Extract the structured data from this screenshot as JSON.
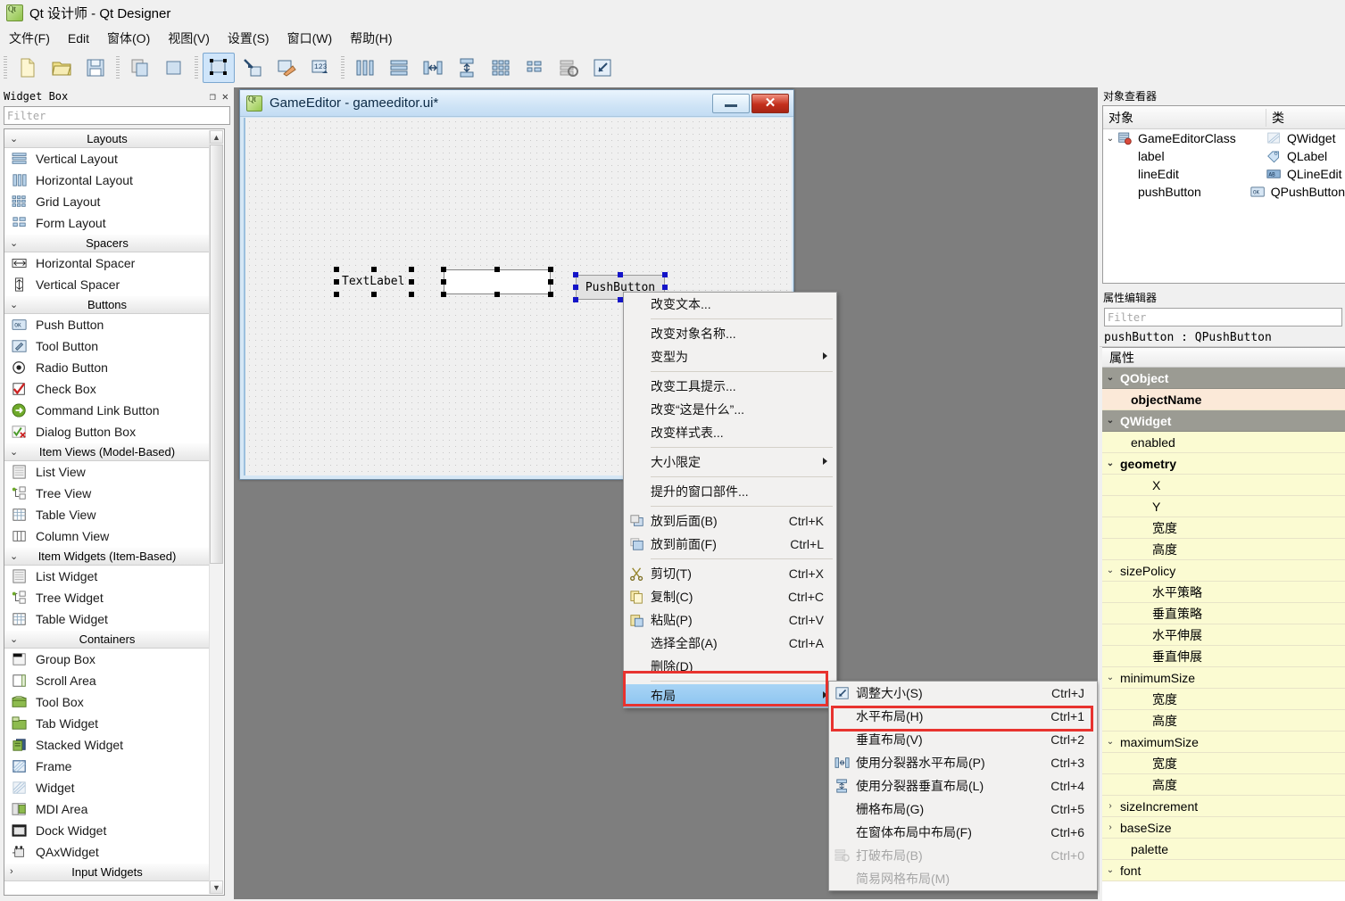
{
  "window": {
    "title": "Qt 设计师 - Qt Designer",
    "app_icon": "qt-icon"
  },
  "menubar": {
    "items": [
      {
        "label": "文件(F)"
      },
      {
        "label": "Edit"
      },
      {
        "label": "窗体(O)"
      },
      {
        "label": "视图(V)"
      },
      {
        "label": "设置(S)"
      },
      {
        "label": "窗口(W)"
      },
      {
        "label": "帮助(H)"
      }
    ]
  },
  "toolbar": {
    "groups": [
      [
        "new-form-icon",
        "open-form-icon",
        "save-form-icon"
      ],
      [
        "copy-icon",
        "paste-icon"
      ],
      [
        "edit-widgets-icon",
        "edit-signals-icon",
        "edit-buddies-icon",
        "edit-tab-order-icon"
      ],
      [
        "layout-horizontal-icon",
        "layout-vertical-icon",
        "layout-splitter-h-icon",
        "layout-splitter-v-icon",
        "layout-grid-icon",
        "layout-form-icon",
        "break-layout-icon",
        "adjust-size-icon"
      ]
    ],
    "active_index": "edit-widgets-icon"
  },
  "widget_box": {
    "title": "Widget Box",
    "float_btn": "float-icon",
    "close_btn": "close-icon",
    "filter_placeholder": "Filter",
    "groups": [
      {
        "name": "Layouts",
        "expanded": true,
        "items": [
          {
            "label": "Vertical Layout",
            "icon": "vertical-layout-icon"
          },
          {
            "label": "Horizontal Layout",
            "icon": "horizontal-layout-icon"
          },
          {
            "label": "Grid Layout",
            "icon": "grid-layout-icon"
          },
          {
            "label": "Form Layout",
            "icon": "form-layout-icon"
          }
        ]
      },
      {
        "name": "Spacers",
        "expanded": true,
        "items": [
          {
            "label": "Horizontal Spacer",
            "icon": "horizontal-spacer-icon"
          },
          {
            "label": "Vertical Spacer",
            "icon": "vertical-spacer-icon"
          }
        ]
      },
      {
        "name": "Buttons",
        "expanded": true,
        "items": [
          {
            "label": "Push Button",
            "icon": "push-button-icon"
          },
          {
            "label": "Tool Button",
            "icon": "tool-button-icon"
          },
          {
            "label": "Radio Button",
            "icon": "radio-button-icon"
          },
          {
            "label": "Check Box",
            "icon": "check-box-icon"
          },
          {
            "label": "Command Link Button",
            "icon": "command-link-icon"
          },
          {
            "label": "Dialog Button Box",
            "icon": "dialog-button-box-icon"
          }
        ]
      },
      {
        "name": "Item Views (Model-Based)",
        "expanded": true,
        "items": [
          {
            "label": "List View",
            "icon": "list-view-icon"
          },
          {
            "label": "Tree View",
            "icon": "tree-view-icon"
          },
          {
            "label": "Table View",
            "icon": "table-view-icon"
          },
          {
            "label": "Column View",
            "icon": "column-view-icon"
          }
        ]
      },
      {
        "name": "Item Widgets (Item-Based)",
        "expanded": true,
        "items": [
          {
            "label": "List Widget",
            "icon": "list-widget-icon"
          },
          {
            "label": "Tree Widget",
            "icon": "tree-widget-icon"
          },
          {
            "label": "Table Widget",
            "icon": "table-widget-icon"
          }
        ]
      },
      {
        "name": "Containers",
        "expanded": true,
        "items": [
          {
            "label": "Group Box",
            "icon": "group-box-icon"
          },
          {
            "label": "Scroll Area",
            "icon": "scroll-area-icon"
          },
          {
            "label": "Tool Box",
            "icon": "tool-box-icon"
          },
          {
            "label": "Tab Widget",
            "icon": "tab-widget-icon"
          },
          {
            "label": "Stacked Widget",
            "icon": "stacked-widget-icon"
          },
          {
            "label": "Frame",
            "icon": "frame-icon"
          },
          {
            "label": "Widget",
            "icon": "widget-icon"
          },
          {
            "label": "MDI Area",
            "icon": "mdi-area-icon"
          },
          {
            "label": "Dock Widget",
            "icon": "dock-widget-icon"
          },
          {
            "label": "QAxWidget",
            "icon": "qax-widget-icon"
          }
        ]
      },
      {
        "name": "Input Widgets",
        "expanded": false,
        "items": []
      }
    ]
  },
  "form_window": {
    "title": "GameEditor - gameeditor.ui*",
    "minimize_label": "",
    "close_label": "✕",
    "widgets": [
      {
        "name": "label",
        "text": "TextLabel",
        "selected": true,
        "handle_color": "#000000"
      },
      {
        "name": "lineEdit",
        "text": "",
        "selected": true,
        "handle_color": "#000000"
      },
      {
        "name": "pushButton",
        "text": "PushButton",
        "selected": true,
        "handle_color": "#1414c8"
      }
    ]
  },
  "context_menu": {
    "items": [
      {
        "label": "改变文本...",
        "shortcut": "",
        "icon": "",
        "submenu": false
      },
      {
        "separator": true
      },
      {
        "label": "改变对象名称...",
        "shortcut": "",
        "icon": "",
        "submenu": false
      },
      {
        "label": "变型为",
        "shortcut": "",
        "icon": "",
        "submenu": true
      },
      {
        "separator": true
      },
      {
        "label": "改变工具提示...",
        "shortcut": "",
        "icon": "",
        "submenu": false
      },
      {
        "label": "改变“这是什么”...",
        "shortcut": "",
        "icon": "",
        "submenu": false
      },
      {
        "label": "改变样式表...",
        "shortcut": "",
        "icon": "",
        "submenu": false
      },
      {
        "separator": true
      },
      {
        "label": "大小限定",
        "shortcut": "",
        "icon": "",
        "submenu": true
      },
      {
        "separator": true
      },
      {
        "label": "提升的窗口部件...",
        "shortcut": "",
        "icon": "",
        "submenu": false
      },
      {
        "separator": true
      },
      {
        "label": "放到后面(B)",
        "shortcut": "Ctrl+K",
        "icon": "send-to-back-icon",
        "submenu": false
      },
      {
        "label": "放到前面(F)",
        "shortcut": "Ctrl+L",
        "icon": "bring-to-front-icon",
        "submenu": false
      },
      {
        "separator": true
      },
      {
        "label": "剪切(T)",
        "shortcut": "Ctrl+X",
        "icon": "cut-icon",
        "submenu": false
      },
      {
        "label": "复制(C)",
        "shortcut": "Ctrl+C",
        "icon": "copy-icon",
        "submenu": false
      },
      {
        "label": "粘贴(P)",
        "shortcut": "Ctrl+V",
        "icon": "paste-icon",
        "submenu": false
      },
      {
        "label": "选择全部(A)",
        "shortcut": "Ctrl+A",
        "icon": "",
        "submenu": false
      },
      {
        "label": "删除(D)",
        "shortcut": "",
        "icon": "",
        "submenu": false
      },
      {
        "separator": true
      },
      {
        "label": "布局",
        "shortcut": "",
        "icon": "",
        "submenu": true,
        "selected": true,
        "highlighted": true
      }
    ]
  },
  "layout_submenu": {
    "items": [
      {
        "label": "调整大小(S)",
        "shortcut": "Ctrl+J",
        "icon": "adjust-size-icon",
        "disabled": false,
        "highlighted": false
      },
      {
        "label": "水平布局(H)",
        "shortcut": "Ctrl+1",
        "icon": "layout-horizontal-icon",
        "disabled": false,
        "highlighted": true
      },
      {
        "label": "垂直布局(V)",
        "shortcut": "Ctrl+2",
        "icon": "layout-vertical-icon",
        "disabled": false,
        "highlighted": false
      },
      {
        "label": "使用分裂器水平布局(P)",
        "shortcut": "Ctrl+3",
        "icon": "layout-splitter-h-icon",
        "disabled": false,
        "highlighted": false
      },
      {
        "label": "使用分裂器垂直布局(L)",
        "shortcut": "Ctrl+4",
        "icon": "layout-splitter-v-icon",
        "disabled": false,
        "highlighted": false
      },
      {
        "label": "栅格布局(G)",
        "shortcut": "Ctrl+5",
        "icon": "layout-grid-icon",
        "disabled": false,
        "highlighted": false
      },
      {
        "label": "在窗体布局中布局(F)",
        "shortcut": "Ctrl+6",
        "icon": "layout-form-icon",
        "disabled": false,
        "highlighted": false
      },
      {
        "label": "打破布局(B)",
        "shortcut": "Ctrl+0",
        "icon": "break-layout-icon",
        "disabled": true,
        "highlighted": false
      },
      {
        "label": "简易网格布局(M)",
        "shortcut": "",
        "icon": "",
        "disabled": true,
        "highlighted": false
      }
    ]
  },
  "object_inspector": {
    "title": "对象查看器",
    "columns": [
      "对象",
      "类"
    ],
    "rows": [
      {
        "object": "GameEditorClass",
        "class": "QWidget",
        "icon": "widget-icon",
        "class_icon": "qwidget-icon",
        "level": 0,
        "expanded": true
      },
      {
        "object": "label",
        "class": "QLabel",
        "icon": "",
        "class_icon": "qlabel-icon",
        "level": 1,
        "expanded": false
      },
      {
        "object": "lineEdit",
        "class": "QLineEdit",
        "icon": "",
        "class_icon": "qlineedit-icon",
        "level": 1,
        "expanded": false
      },
      {
        "object": "pushButton",
        "class": "QPushButton",
        "icon": "",
        "class_icon": "qpushbutton-icon",
        "level": 1,
        "expanded": false
      }
    ]
  },
  "property_editor": {
    "title": "属性编辑器",
    "filter_placeholder": "Filter",
    "object_line": "pushButton : QPushButton",
    "column_header": "属性",
    "rows": [
      {
        "label": "QObject",
        "style": "group",
        "chev": "v",
        "indent": 0
      },
      {
        "label": "objectName",
        "style": "modified",
        "chev": "",
        "indent": 1
      },
      {
        "label": "QWidget",
        "style": "group",
        "chev": "v",
        "indent": 0
      },
      {
        "label": "enabled",
        "style": "yellow",
        "chev": "",
        "indent": 1
      },
      {
        "label": "geometry",
        "style": "yellowb",
        "chev": "v",
        "indent": 0
      },
      {
        "label": "X",
        "style": "yellow",
        "chev": "",
        "indent": 2
      },
      {
        "label": "Y",
        "style": "yellow",
        "chev": "",
        "indent": 2
      },
      {
        "label": "宽度",
        "style": "yellow",
        "chev": "",
        "indent": 2
      },
      {
        "label": "高度",
        "style": "yellow",
        "chev": "",
        "indent": 2
      },
      {
        "label": "sizePolicy",
        "style": "yellow",
        "chev": "v",
        "indent": 0
      },
      {
        "label": "水平策略",
        "style": "yellow",
        "chev": "",
        "indent": 2
      },
      {
        "label": "垂直策略",
        "style": "yellow",
        "chev": "",
        "indent": 2
      },
      {
        "label": "水平伸展",
        "style": "yellow",
        "chev": "",
        "indent": 2
      },
      {
        "label": "垂直伸展",
        "style": "yellow",
        "chev": "",
        "indent": 2
      },
      {
        "label": "minimumSize",
        "style": "yellow",
        "chev": "v",
        "indent": 0
      },
      {
        "label": "宽度",
        "style": "yellow",
        "chev": "",
        "indent": 2
      },
      {
        "label": "高度",
        "style": "yellow",
        "chev": "",
        "indent": 2
      },
      {
        "label": "maximumSize",
        "style": "yellow",
        "chev": "v",
        "indent": 0
      },
      {
        "label": "宽度",
        "style": "yellow",
        "chev": "",
        "indent": 2
      },
      {
        "label": "高度",
        "style": "yellow",
        "chev": "",
        "indent": 2
      },
      {
        "label": "sizeIncrement",
        "style": "yellow",
        "chev": ">",
        "indent": 0
      },
      {
        "label": "baseSize",
        "style": "yellow",
        "chev": ">",
        "indent": 0
      },
      {
        "label": "palette",
        "style": "yellow",
        "chev": "",
        "indent": 1
      },
      {
        "label": "font",
        "style": "yellow",
        "chev": "v",
        "indent": 0
      }
    ]
  },
  "colors": {
    "accent_red": "#e8332f",
    "menu_highlight": "#8cc4f0",
    "workspace_bg": "#7e7e7e",
    "property_yellow": "#fbfbd2",
    "property_modified": "#fbe9d8",
    "group_gray": "#9b9b93"
  }
}
